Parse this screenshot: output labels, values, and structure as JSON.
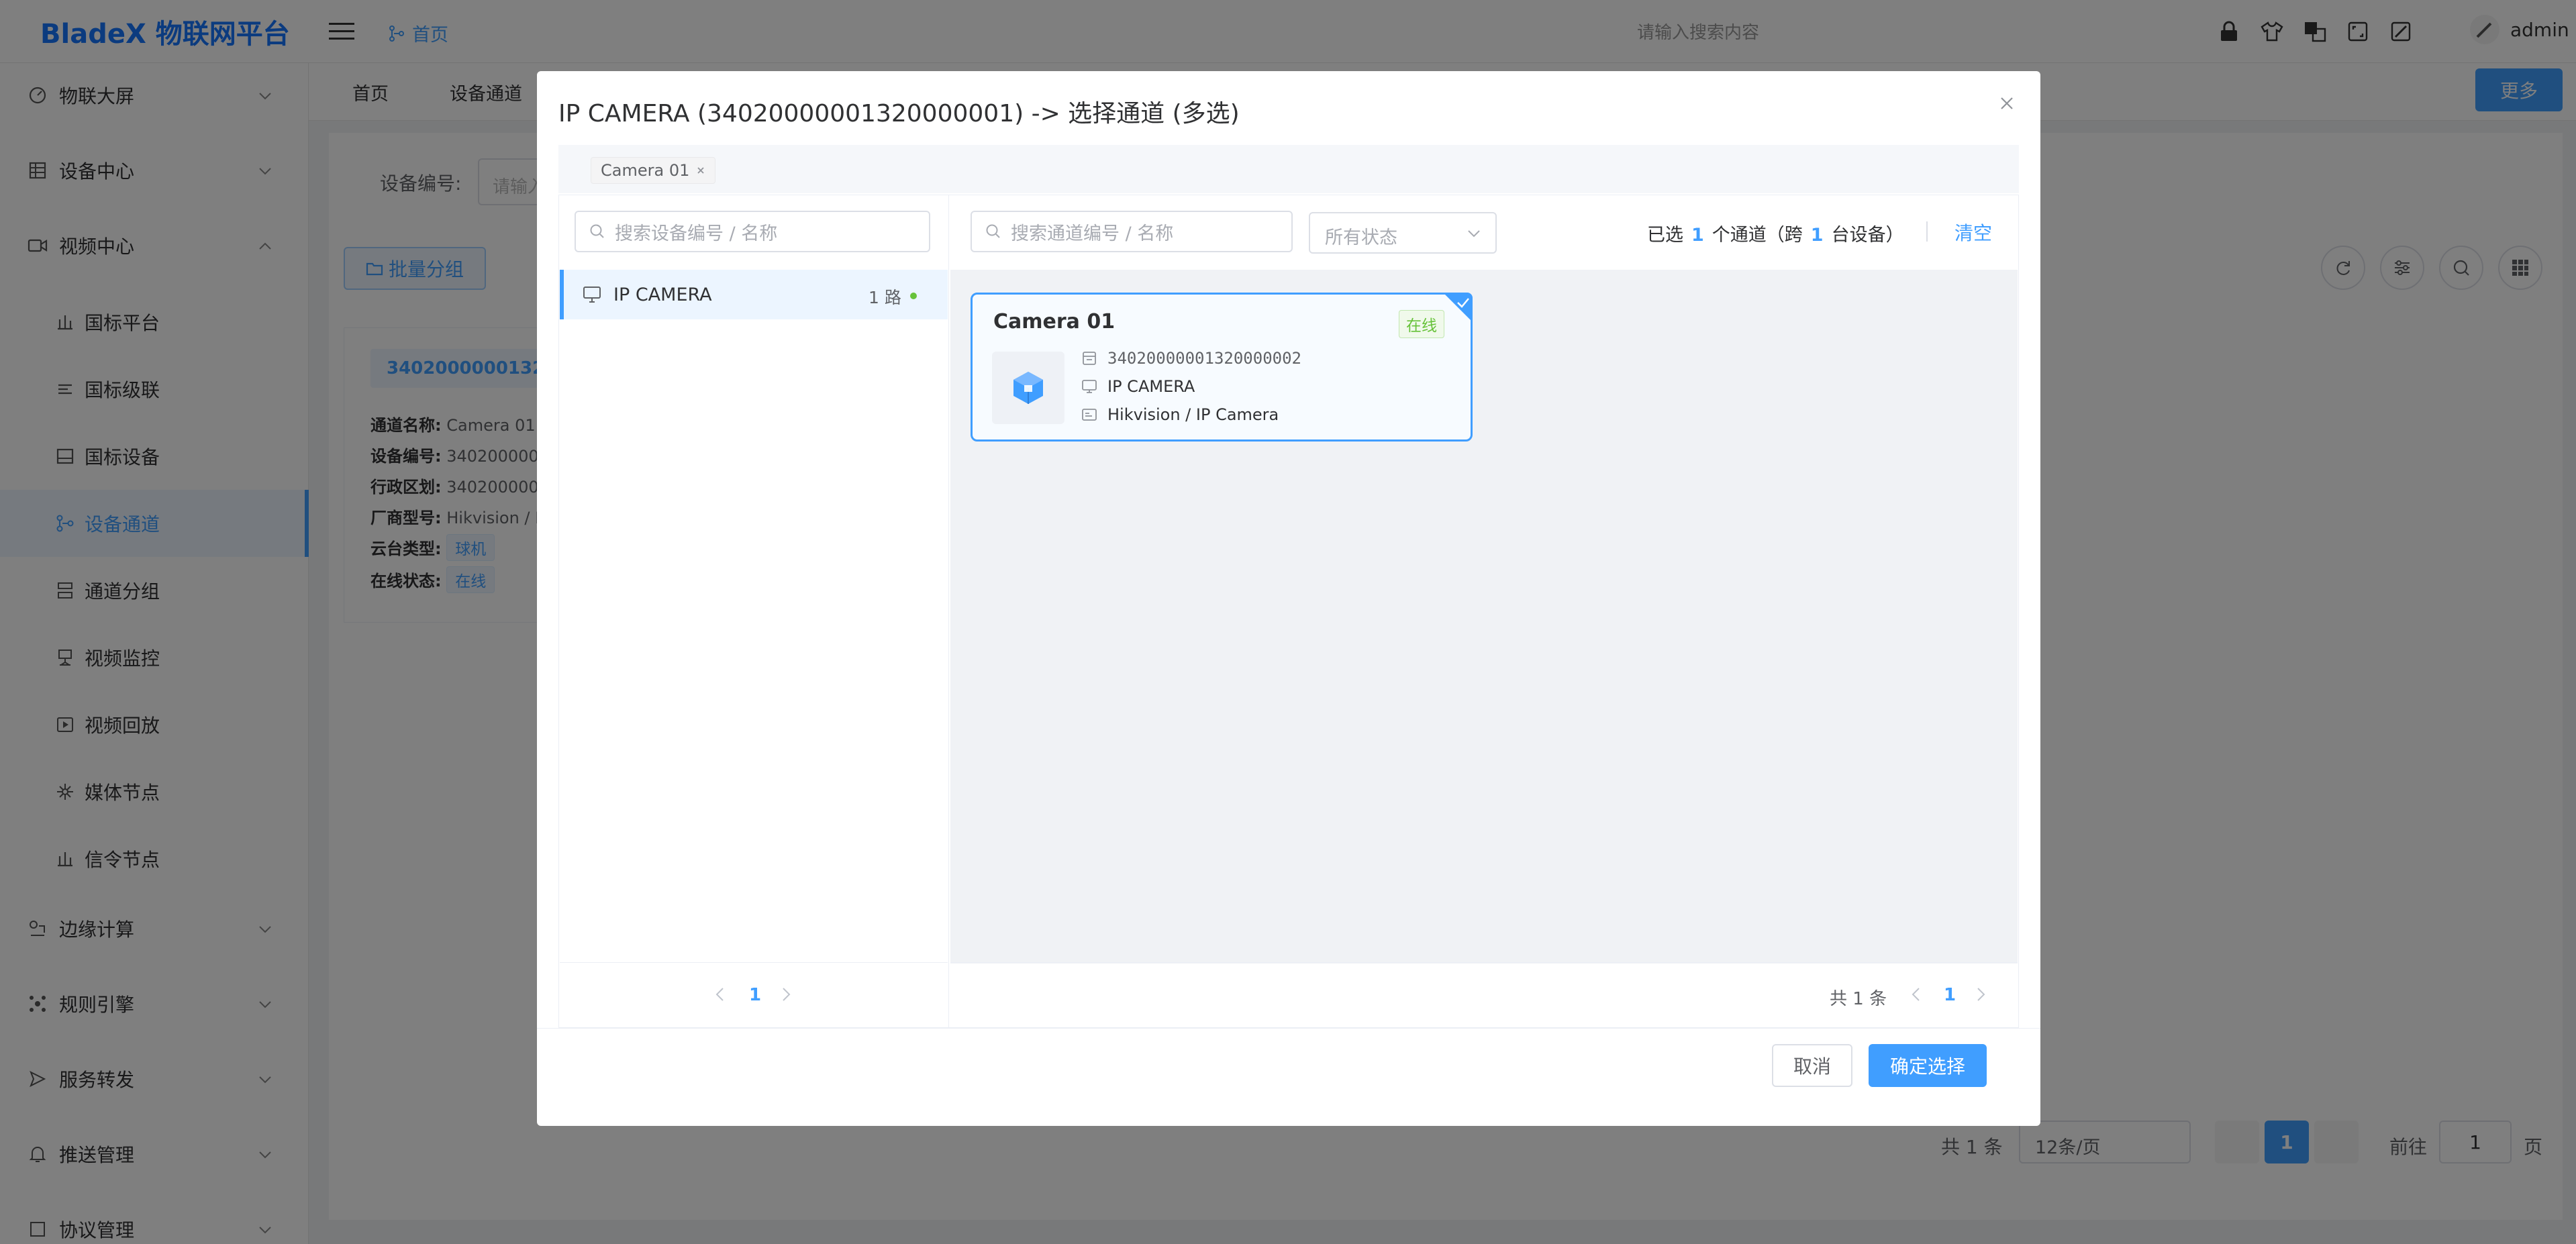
{
  "app": {
    "logo": "BladeX 物联网平台",
    "home_crumb": "首页",
    "search_placeholder": "请输入搜索内容",
    "user": "admin"
  },
  "sidebar": {
    "items": [
      {
        "label": "物联大屏",
        "icon": "dashboard-icon"
      },
      {
        "label": "设备中心",
        "icon": "device-center-icon"
      },
      {
        "label": "视频中心",
        "icon": "video-icon"
      },
      {
        "label": "边缘计算",
        "icon": "edge-icon"
      },
      {
        "label": "规则引擎",
        "icon": "rule-icon"
      },
      {
        "label": "服务转发",
        "icon": "forward-icon"
      },
      {
        "label": "推送管理",
        "icon": "bell-icon"
      },
      {
        "label": "协议管理",
        "icon": "protocol-icon"
      }
    ],
    "video_sub": [
      {
        "label": "国标平台"
      },
      {
        "label": "国标级联"
      },
      {
        "label": "国标设备"
      },
      {
        "label": "设备通道"
      },
      {
        "label": "通道分组"
      },
      {
        "label": "视频监控"
      },
      {
        "label": "视频回放"
      },
      {
        "label": "媒体节点"
      },
      {
        "label": "信令节点"
      }
    ]
  },
  "tabs": [
    {
      "label": "首页"
    },
    {
      "label": "设备通道"
    }
  ],
  "more_label": "更多",
  "filter": {
    "label": "设备编号:",
    "placeholder": "请输入"
  },
  "batch_label": "批量分组",
  "card": {
    "id": "34020000001320000002",
    "rows": [
      {
        "k": "通道名称:",
        "v": "Camera 01"
      },
      {
        "k": "设备编号:",
        "v": "340200000013"
      },
      {
        "k": "行政区划:",
        "v": "340200000013"
      },
      {
        "k": "厂商型号:",
        "v": "Hikvision / I"
      },
      {
        "k": "云台类型:",
        "v": "球机"
      },
      {
        "k": "在线状态:",
        "v": "在线"
      }
    ]
  },
  "pager_bottom": {
    "total": "共 1 条",
    "size": "12条/页",
    "page": "1",
    "goto": "前往",
    "goto_value": "1",
    "unit": "页"
  },
  "dialog": {
    "title": "IP CAMERA (34020000001320000001) -> 选择通道 (多选)",
    "selected_tag": "Camera 01",
    "device_search_placeholder": "搜索设备编号 / 名称",
    "device_name": "IP CAMERA",
    "device_count": "1 路",
    "channel_search_placeholder": "搜索通道编号 / 名称",
    "status_placeholder": "所有状态",
    "summary": {
      "prefix": "已选",
      "channels": "1",
      "mid": "个通道（跨",
      "devices": "1",
      "suffix": "台设备）"
    },
    "clear_label": "清空",
    "channel": {
      "name": "Camera 01",
      "status": "在线",
      "code": "34020000001320000002",
      "device": "IP CAMERA",
      "vendor": "Hikvision / IP Camera"
    },
    "left_page": "1",
    "right_total": "共 1 条",
    "right_page": "1",
    "cancel_label": "取消",
    "confirm_label": "确定选择"
  },
  "colors": {
    "primary": "#409eff",
    "success": "#67c23a"
  }
}
